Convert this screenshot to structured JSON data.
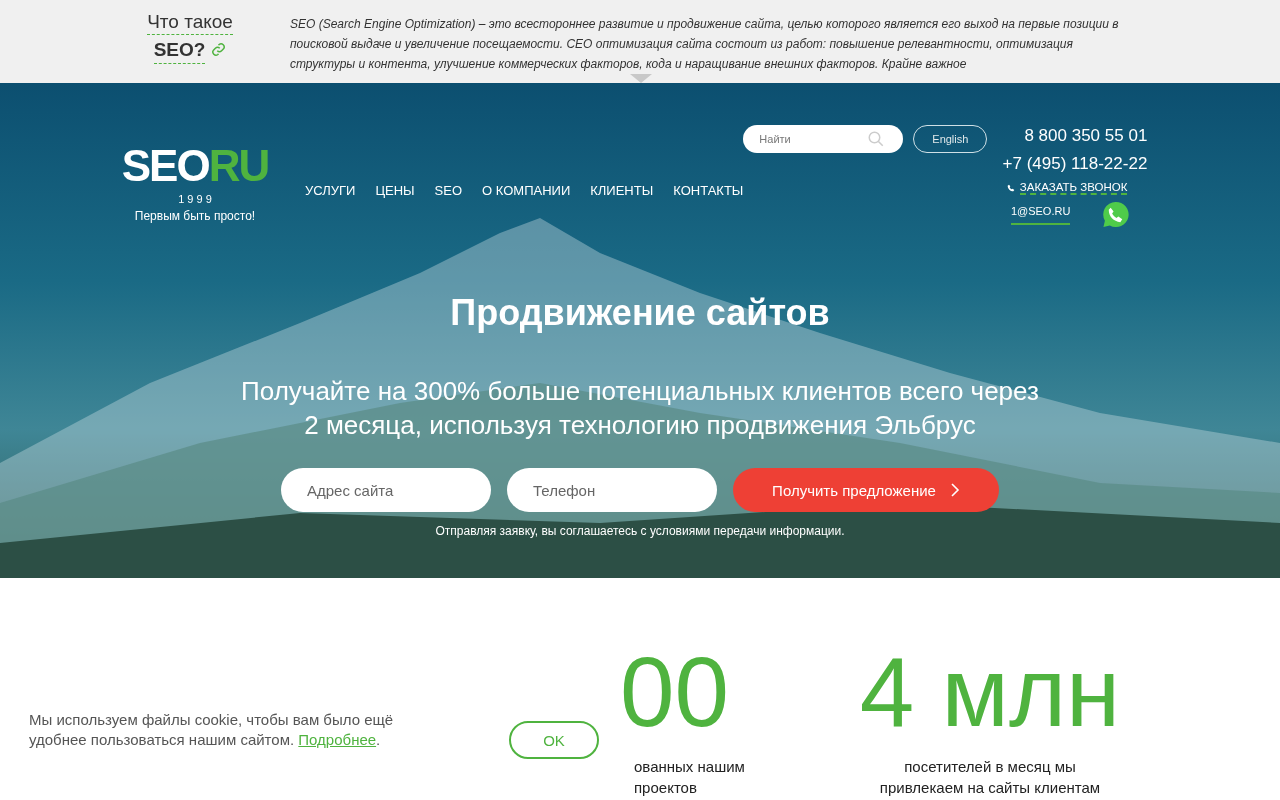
{
  "info_bar": {
    "title_line1": "Что такое",
    "title_line2": "SEO?",
    "text": "SEO (Search Engine Optimization) – это всестороннее развитие и продвижение сайта, целью которого является его выход на первые позиции в поисковой выдаче и увеличение посещаемости. СЕО оптимизация сайта состоит из работ: повышение релевантности, оптимизация структуры и контента, улучшение коммерческих факторов, кода и наращивание внешних факторов. Крайне важное"
  },
  "logo": {
    "text_white": "SEO",
    "text_green": "RU",
    "year": "1 9 9 9",
    "slogan": "Первым быть просто!"
  },
  "nav": [
    {
      "label": "УСЛУГИ"
    },
    {
      "label": "ЦЕНЫ"
    },
    {
      "label": "SEO"
    },
    {
      "label": "О КОМПАНИИ"
    },
    {
      "label": "КЛИЕНТЫ"
    },
    {
      "label": "КОНТАКТЫ"
    }
  ],
  "search": {
    "placeholder": "Найти"
  },
  "language_button": "English",
  "contacts": {
    "phone1": "8 800 350 55 01",
    "phone2": "+7 (495) 118-22-22",
    "callback": "ЗАКАЗАТЬ ЗВОНОК",
    "email": "1@SEO.RU"
  },
  "hero": {
    "title": "Продвижение сайтов",
    "subtitle_line1": "Получайте на 300% больше потенциальных клиентов всего через",
    "subtitle_line2": "2 месяца, используя технологию продвижения Эльбрус",
    "site_field": {
      "placeholder": "Адрес сайта"
    },
    "phone_field": {
      "placeholder": "Телефон"
    },
    "submit": "Получить предложение",
    "note": "Отправляя заявку, вы соглашаетесь с условиями передачи информации."
  },
  "stats": [
    {
      "number": "00",
      "description": [
        "ованных нашим",
        "проектов"
      ]
    },
    {
      "number": "4 млн",
      "description": [
        "посетителей в месяц мы",
        "привлекаем на сайты клиентам"
      ]
    }
  ],
  "cookie": {
    "text": "Мы используем файлы cookie, чтобы вам было ещё удобнее пользоваться нашим сайтом.",
    "link": "Подробнее",
    "link_suffix": ".",
    "button": "OK"
  }
}
